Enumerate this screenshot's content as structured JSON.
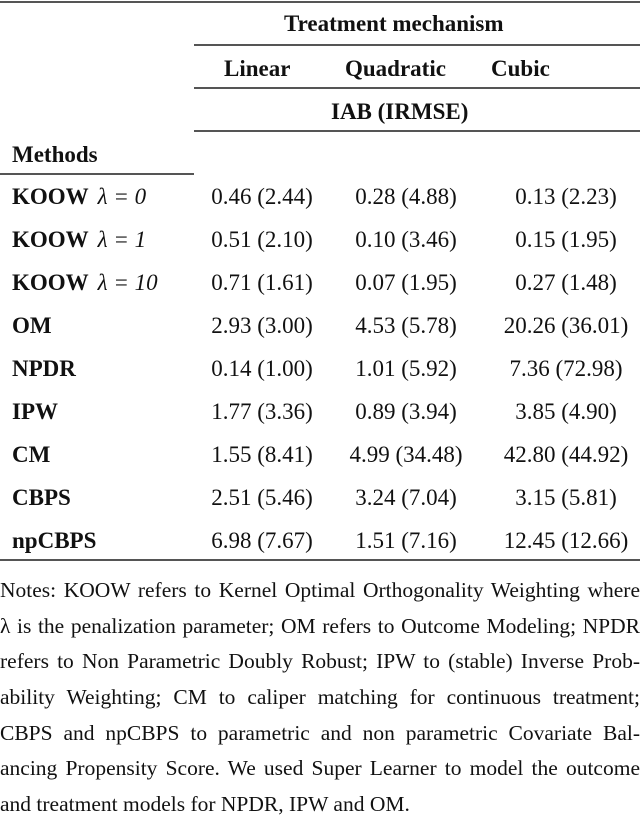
{
  "table": {
    "group_header": "Treatment mechanism",
    "columns": [
      "Linear",
      "Quadratic",
      "Cubic"
    ],
    "metric_header": "IAB (IRMSE)",
    "row_header": "Methods",
    "rows": [
      {
        "method": "KOOW",
        "param": "λ = 0",
        "values": [
          "0.46 (2.44)",
          "0.28 (4.88)",
          "0.13 (2.23)"
        ]
      },
      {
        "method": "KOOW",
        "param": "λ = 1",
        "values": [
          "0.51 (2.10)",
          "0.10 (3.46)",
          "0.15 (1.95)"
        ]
      },
      {
        "method": "KOOW",
        "param": "λ = 10",
        "values": [
          "0.71 (1.61)",
          "0.07 (1.95)",
          "0.27 (1.48)"
        ]
      },
      {
        "method": "OM",
        "param": "",
        "values": [
          "2.93 (3.00)",
          "4.53 (5.78)",
          "20.26 (36.01)"
        ]
      },
      {
        "method": "NPDR",
        "param": "",
        "values": [
          "0.14 (1.00)",
          "1.01 (5.92)",
          "7.36 (72.98)"
        ]
      },
      {
        "method": "IPW",
        "param": "",
        "values": [
          "1.77 (3.36)",
          "0.89 (3.94)",
          "3.85 (4.90)"
        ]
      },
      {
        "method": "CM",
        "param": "",
        "values": [
          "1.55 (8.41)",
          "4.99 (34.48)",
          "42.80 (44.92)"
        ]
      },
      {
        "method": "CBPS",
        "param": "",
        "values": [
          "2.51 (5.46)",
          "3.24 (7.04)",
          "3.15 (5.81)"
        ]
      },
      {
        "method": "npCBPS",
        "param": "",
        "values": [
          "6.98 (7.67)",
          "1.51 (7.16)",
          "12.45 (12.66)"
        ]
      }
    ]
  },
  "notes": [
    "Notes: KOOW refers to Kernel Optimal Orthogonality Weighting where",
    "λ is the penalization parameter; OM refers to Outcome Modeling; NPDR",
    "refers to Non Parametric Doubly Robust; IPW to (stable) Inverse Prob-",
    "ability Weighting; CM to caliper matching for continuous treatment;",
    "CBPS and npCBPS to parametric and non parametric Covariate Bal-",
    "ancing Propensity Score. We used Super Learner to model the outcome",
    "and treatment models for NPDR, IPW and OM."
  ]
}
